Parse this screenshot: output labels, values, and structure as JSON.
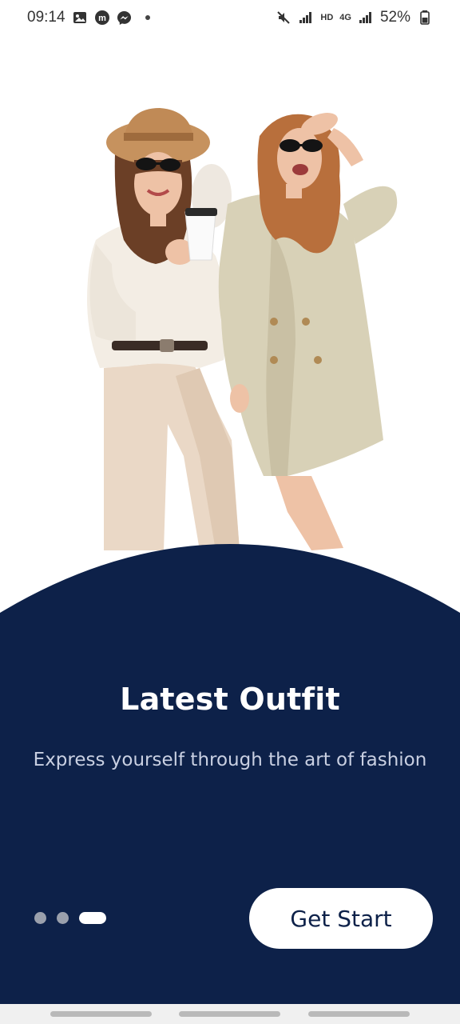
{
  "status_bar": {
    "time": "09:14",
    "battery": "52%",
    "network_label": "HD",
    "network_type": "4G",
    "icons": [
      "gallery-icon",
      "app-m-icon",
      "messenger-icon",
      "mute-icon",
      "signal-icon",
      "signal-icon",
      "battery-icon"
    ]
  },
  "onboarding": {
    "title": "Latest Outfit",
    "subtitle": "Express yourself through the art of fashion",
    "button_label": "Get Start",
    "page_indicator": {
      "total": 3,
      "current": 3
    }
  },
  "colors": {
    "primary": "#0d2149",
    "background": "#ffffff",
    "subtitle": "#c9d0e2",
    "inactive_dot": "#9aa0ac"
  }
}
